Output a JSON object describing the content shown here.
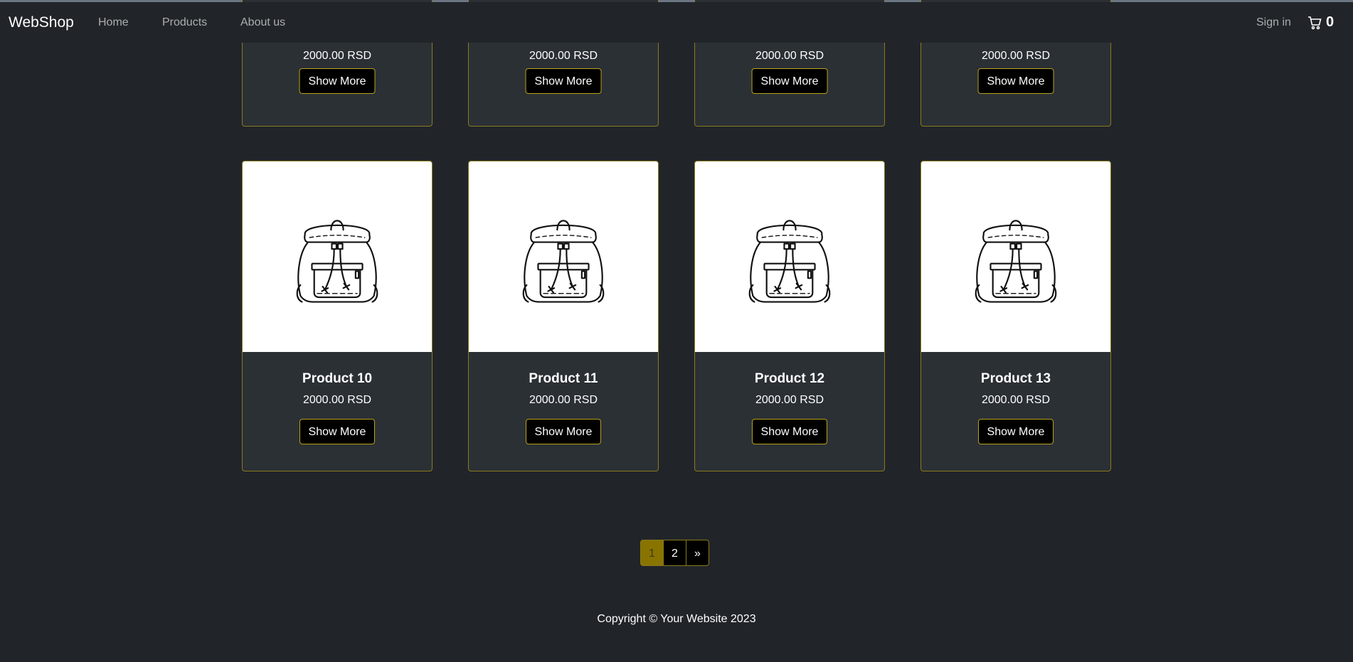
{
  "navbar": {
    "brand": "WebShop",
    "links": [
      "Home",
      "Products",
      "About us"
    ],
    "signin": "Sign in",
    "cart_icon": "cart-icon",
    "cart_count": "0"
  },
  "top_row": [
    {
      "price": "2000.00 RSD",
      "button": "Show More"
    },
    {
      "price": "2000.00 RSD",
      "button": "Show More"
    },
    {
      "price": "2000.00 RSD",
      "button": "Show More"
    },
    {
      "price": "2000.00 RSD",
      "button": "Show More"
    }
  ],
  "products": [
    {
      "title": "Product 10",
      "price": "2000.00 RSD",
      "button": "Show More",
      "image_icon": "backpack-icon"
    },
    {
      "title": "Product 11",
      "price": "2000.00 RSD",
      "button": "Show More",
      "image_icon": "backpack-icon"
    },
    {
      "title": "Product 12",
      "price": "2000.00 RSD",
      "button": "Show More",
      "image_icon": "backpack-icon"
    },
    {
      "title": "Product 13",
      "price": "2000.00 RSD",
      "button": "Show More",
      "image_icon": "backpack-icon"
    }
  ],
  "pagination": {
    "pages": [
      "1",
      "2"
    ],
    "active": "1",
    "next": "»"
  },
  "footer": {
    "text": "Copyright © Your Website 2023"
  },
  "colors": {
    "background": "#212529",
    "card": "#2b3035",
    "accent_border": "#8a7a1c",
    "active_page": "#8a7400"
  }
}
